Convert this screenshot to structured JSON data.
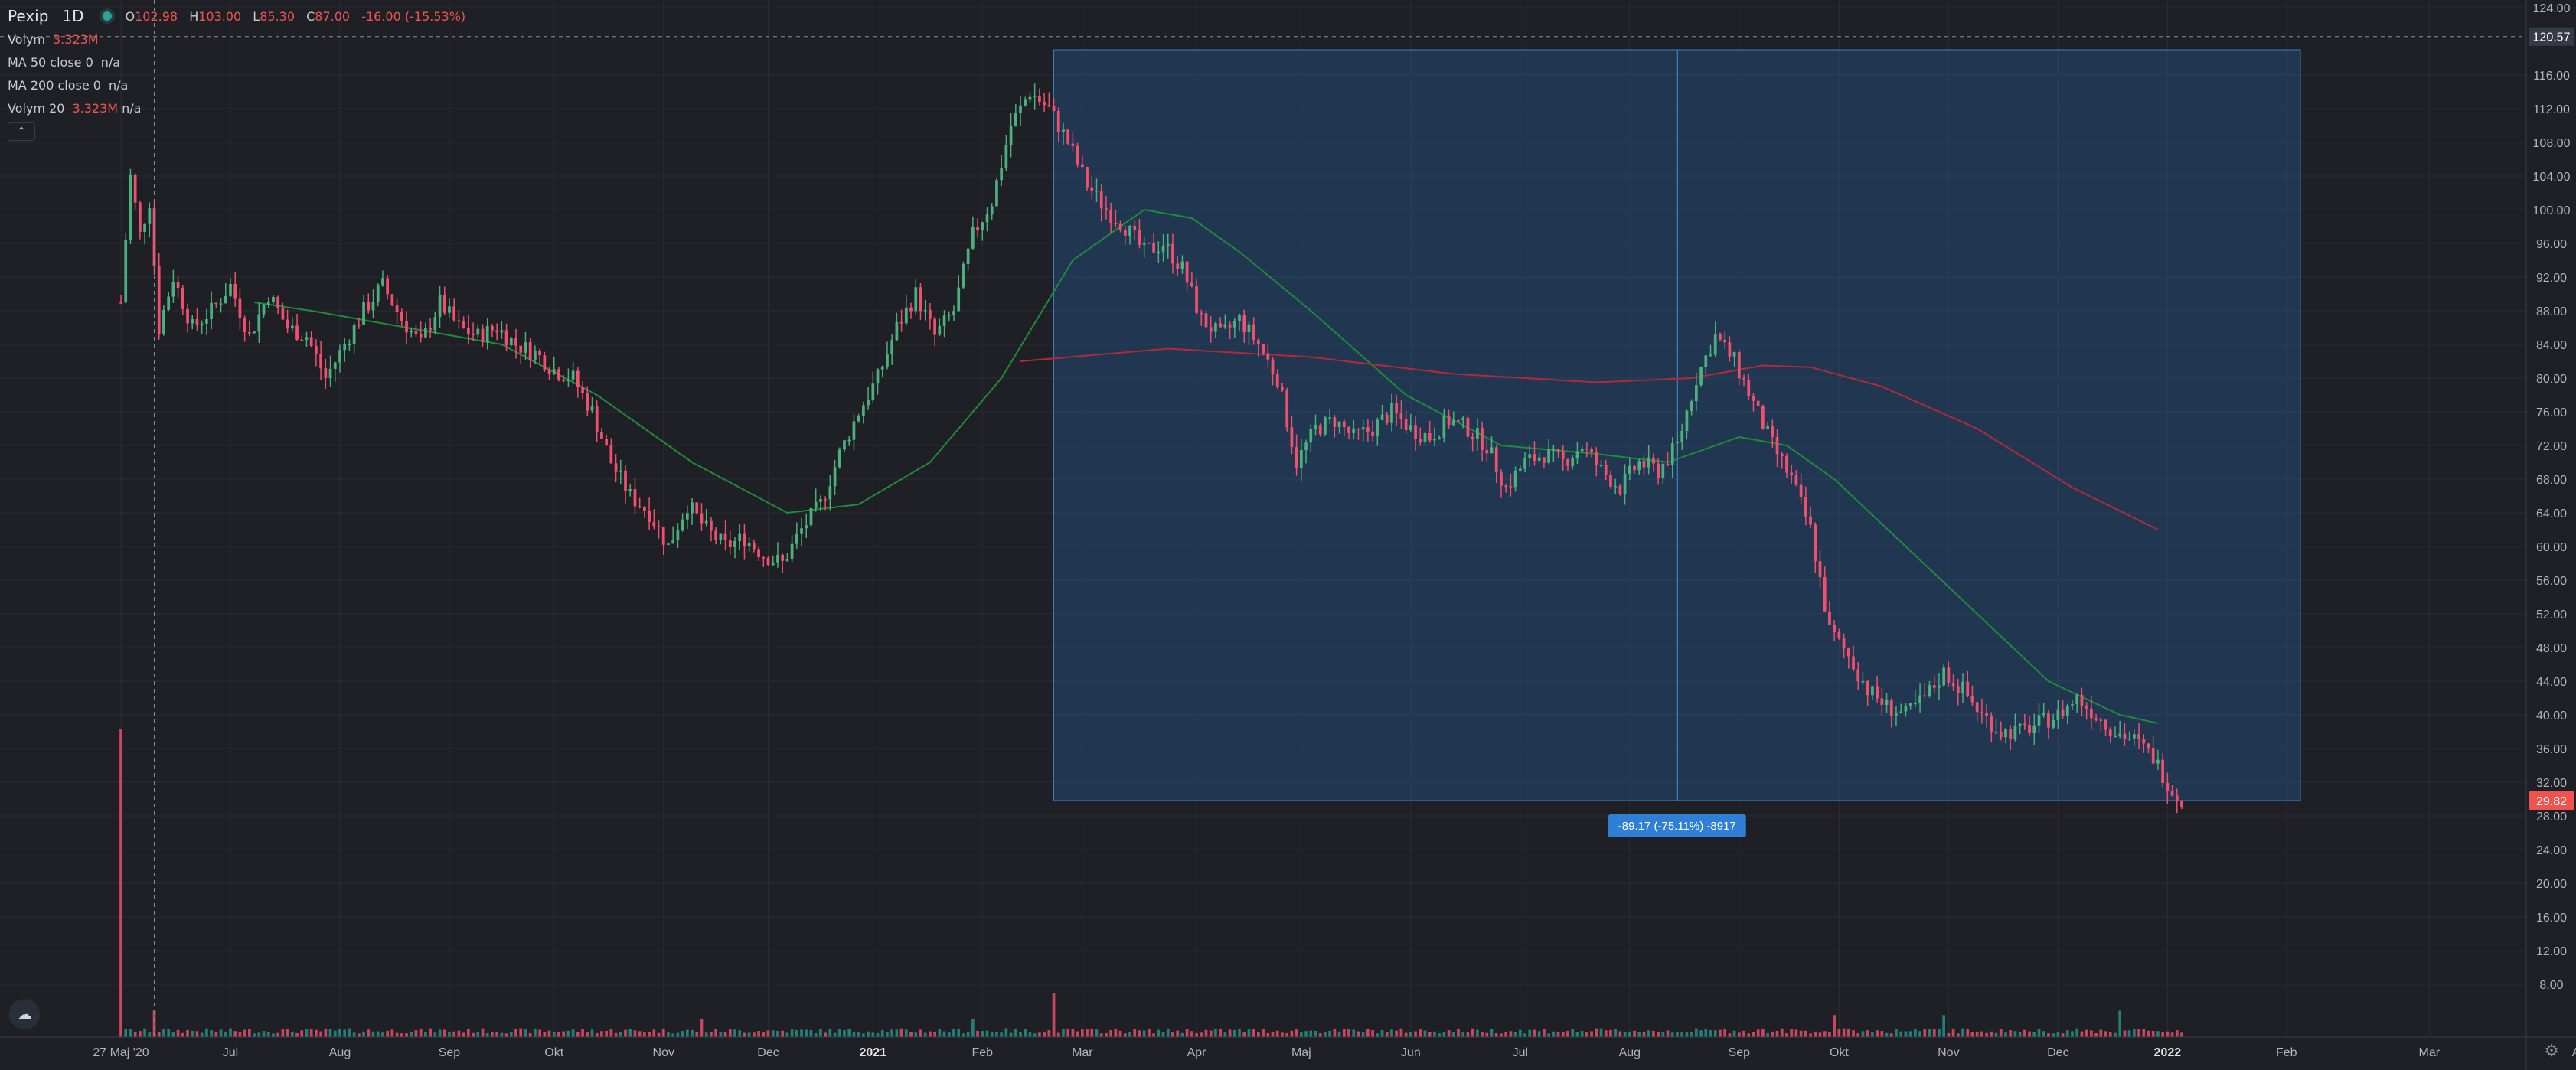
{
  "legend": {
    "symbol": "Pexip",
    "timeframe": "1D",
    "ohlc": {
      "o_label": "O",
      "o": "102.98",
      "h_label": "H",
      "h": "103.00",
      "l_label": "L",
      "l": "85.30",
      "c_label": "C",
      "c": "87.00",
      "change": "-16.00 (-15.53%)"
    },
    "indicators": [
      {
        "name": "Volym",
        "value": "3.323M",
        "na": ""
      },
      {
        "name": "MA 50 close 0",
        "value": "",
        "na": "n/a"
      },
      {
        "name": "MA 200 close 0",
        "value": "",
        "na": "n/a"
      },
      {
        "name": "Volym 20",
        "value": "3.323M",
        "na": "n/a"
      }
    ],
    "collapse_icon": "chevron-up-icon"
  },
  "chart_data": {
    "type": "candlestick",
    "title": "Pexip",
    "price_axis": {
      "ticks": [
        "124.00",
        "120.57",
        "116.00",
        "112.00",
        "108.00",
        "104.00",
        "100.00",
        "96.00",
        "92.00",
        "88.00",
        "84.00",
        "80.00",
        "76.00",
        "72.00",
        "68.00",
        "64.00",
        "60.00",
        "56.00",
        "52.00",
        "48.00",
        "44.00",
        "40.00",
        "36.00",
        "32.00",
        "29.82",
        "28.00",
        "24.00",
        "20.00",
        "16.00",
        "12.00",
        "8.00"
      ],
      "ylim": [
        4,
        124
      ],
      "crosshair_price": "120.57",
      "last_price": "29.82"
    },
    "time_axis": {
      "labels": [
        "27 Maj '20",
        "Jul",
        "Aug",
        "Sep",
        "Okt",
        "Nov",
        "Dec",
        "2021",
        "Feb",
        "Mar",
        "Apr",
        "Maj",
        "Jun",
        "Jul",
        "Aug",
        "Sep",
        "Okt",
        "Nov",
        "Dec",
        "2022",
        "Feb",
        "Mar",
        "Apr"
      ]
    },
    "price_path": [
      [
        0,
        89
      ],
      [
        2,
        104
      ],
      [
        4,
        97
      ],
      [
        6,
        101
      ],
      [
        8,
        86
      ],
      [
        11,
        92
      ],
      [
        15,
        86
      ],
      [
        19,
        88
      ],
      [
        23,
        91
      ],
      [
        27,
        85
      ],
      [
        31,
        90
      ],
      [
        35,
        86
      ],
      [
        39,
        85
      ],
      [
        43,
        80
      ],
      [
        47,
        84
      ],
      [
        51,
        88
      ],
      [
        55,
        91
      ],
      [
        59,
        87
      ],
      [
        63,
        84
      ],
      [
        67,
        89
      ],
      [
        71,
        86
      ],
      [
        75,
        85
      ],
      [
        79,
        86
      ],
      [
        83,
        84
      ],
      [
        87,
        83
      ],
      [
        91,
        81
      ],
      [
        95,
        80
      ],
      [
        99,
        76
      ],
      [
        103,
        70
      ],
      [
        107,
        66
      ],
      [
        111,
        64
      ],
      [
        115,
        60
      ],
      [
        119,
        65
      ],
      [
        123,
        62
      ],
      [
        127,
        60
      ],
      [
        131,
        61
      ],
      [
        135,
        59
      ],
      [
        139,
        58
      ],
      [
        143,
        62
      ],
      [
        147,
        65
      ],
      [
        151,
        71
      ],
      [
        155,
        76
      ],
      [
        159,
        80
      ],
      [
        163,
        86
      ],
      [
        167,
        90
      ],
      [
        171,
        85
      ],
      [
        175,
        88
      ],
      [
        179,
        97
      ],
      [
        183,
        101
      ],
      [
        187,
        110
      ],
      [
        191,
        114
      ],
      [
        195,
        112
      ],
      [
        199,
        108
      ],
      [
        203,
        103
      ],
      [
        207,
        100
      ],
      [
        211,
        98
      ],
      [
        215,
        95
      ],
      [
        219,
        96
      ],
      [
        223,
        93
      ],
      [
        227,
        87
      ],
      [
        231,
        85
      ],
      [
        235,
        87
      ],
      [
        239,
        84
      ],
      [
        243,
        80
      ],
      [
        247,
        70
      ],
      [
        251,
        74
      ],
      [
        255,
        75
      ],
      [
        259,
        73
      ],
      [
        263,
        74
      ],
      [
        267,
        76
      ],
      [
        271,
        74
      ],
      [
        275,
        73
      ],
      [
        279,
        75
      ],
      [
        283,
        74
      ],
      [
        287,
        72
      ],
      [
        291,
        67
      ],
      [
        295,
        70
      ],
      [
        299,
        71
      ],
      [
        303,
        70
      ],
      [
        307,
        72
      ],
      [
        311,
        69
      ],
      [
        315,
        67
      ],
      [
        319,
        70
      ],
      [
        323,
        69
      ],
      [
        327,
        72
      ],
      [
        331,
        80
      ],
      [
        335,
        85
      ],
      [
        339,
        82
      ],
      [
        343,
        77
      ],
      [
        347,
        72
      ],
      [
        351,
        68
      ],
      [
        355,
        62
      ],
      [
        359,
        50
      ],
      [
        363,
        47
      ],
      [
        367,
        43
      ],
      [
        371,
        41
      ],
      [
        375,
        40
      ],
      [
        379,
        42
      ],
      [
        383,
        45
      ],
      [
        387,
        43
      ],
      [
        391,
        40
      ],
      [
        395,
        38
      ],
      [
        399,
        38
      ],
      [
        403,
        39
      ],
      [
        407,
        40
      ],
      [
        411,
        42
      ],
      [
        415,
        40
      ],
      [
        419,
        38
      ],
      [
        423,
        37
      ],
      [
        427,
        35
      ],
      [
        431,
        31
      ],
      [
        433,
        30
      ]
    ],
    "up_color": "#4caf7d",
    "down_color": "#f0506e",
    "ma50": [
      [
        28,
        89
      ],
      [
        40,
        88
      ],
      [
        60,
        86
      ],
      [
        80,
        84
      ],
      [
        100,
        78
      ],
      [
        120,
        70
      ],
      [
        140,
        64
      ],
      [
        155,
        65
      ],
      [
        170,
        70
      ],
      [
        185,
        80
      ],
      [
        200,
        94
      ],
      [
        215,
        100
      ],
      [
        225,
        99
      ],
      [
        235,
        95
      ],
      [
        250,
        88
      ],
      [
        270,
        78
      ],
      [
        290,
        72
      ],
      [
        310,
        71
      ],
      [
        325,
        70
      ],
      [
        340,
        73
      ],
      [
        350,
        72
      ],
      [
        360,
        68
      ],
      [
        375,
        60
      ],
      [
        390,
        52
      ],
      [
        405,
        44
      ],
      [
        420,
        40
      ],
      [
        428,
        39
      ]
    ],
    "ma50_color": "#1f8a3a",
    "ma200": [
      [
        189,
        82
      ],
      [
        220,
        83.5
      ],
      [
        250,
        82.5
      ],
      [
        280,
        80.5
      ],
      [
        310,
        79.5
      ],
      [
        330,
        80
      ],
      [
        345,
        81.5
      ],
      [
        355,
        81.3
      ],
      [
        370,
        79
      ],
      [
        390,
        74
      ],
      [
        410,
        67
      ],
      [
        428,
        62
      ]
    ],
    "ma200_color": "#b22a3a",
    "volume_spikes": [
      {
        "x": 0,
        "v": 35
      },
      {
        "x": 7,
        "v": 3
      },
      {
        "x": 122,
        "v": 2
      },
      {
        "x": 179,
        "v": 2
      },
      {
        "x": 196,
        "v": 5
      },
      {
        "x": 360,
        "v": 2.5
      },
      {
        "x": 383,
        "v": 2.5
      },
      {
        "x": 420,
        "v": 3
      }
    ],
    "volume_color": "#f0506e",
    "measure": {
      "start_x": 196,
      "end_x": 433,
      "top_price": 119,
      "bottom_price": 29.82,
      "label": "-89.17 (-75.11%) -8917",
      "fill": "rgba(41, 98, 160, 0.35)",
      "label_bg": "#2f7fd6"
    },
    "crosshair_x": 7
  },
  "icons": {
    "logo": "tradingview-logo-icon",
    "settings": "gear-icon"
  }
}
